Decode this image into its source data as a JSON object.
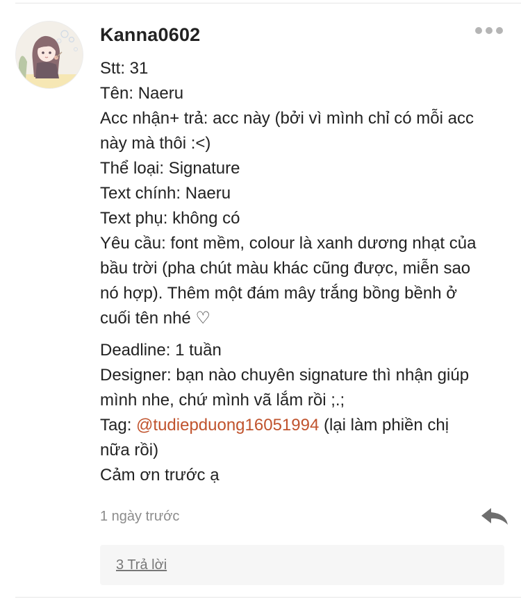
{
  "comment": {
    "username": "Kanna0602",
    "lines": [
      "Stt: 31",
      "Tên: Naeru",
      "Acc nhận+ trả: acc này (bởi vì mình chỉ có mỗi acc",
      "này mà thôi :<)",
      "Thể loại: Signature",
      "Text chính: Naeru",
      "Text phụ: không có",
      "Yêu cầu: font mềm, colour là xanh dương nhạt của",
      "bầu trời (pha chút màu khác cũng được, miễn sao",
      "nó hợp). Thêm một đám mây trắng bồng bềnh ở",
      "cuối tên nhé ♡"
    ],
    "lines2": [
      "Deadline: 1 tuần",
      "Designer: bạn nào chuyên signature thì nhận giúp",
      "mình nhe, chứ mình vã lắm rồi ;.;"
    ],
    "tag_prefix": "Tag: ",
    "tag_mention": "@tudiepduong16051994",
    "tag_suffix": " (lại làm phiền chị",
    "lines3": [
      "nữa rồi)",
      "Cảm ơn trước ạ"
    ],
    "timestamp": "1 ngày trước",
    "replies_label": "3 Trả lời"
  },
  "icons": {
    "more": "more-horizontal-icon",
    "reply": "reply-arrow-icon"
  },
  "colors": {
    "text": "#222222",
    "mention": "#c0532d",
    "muted": "#8b8b8b",
    "reply_icon": "#6e6e6e",
    "replies_bg": "#f6f6f6"
  }
}
